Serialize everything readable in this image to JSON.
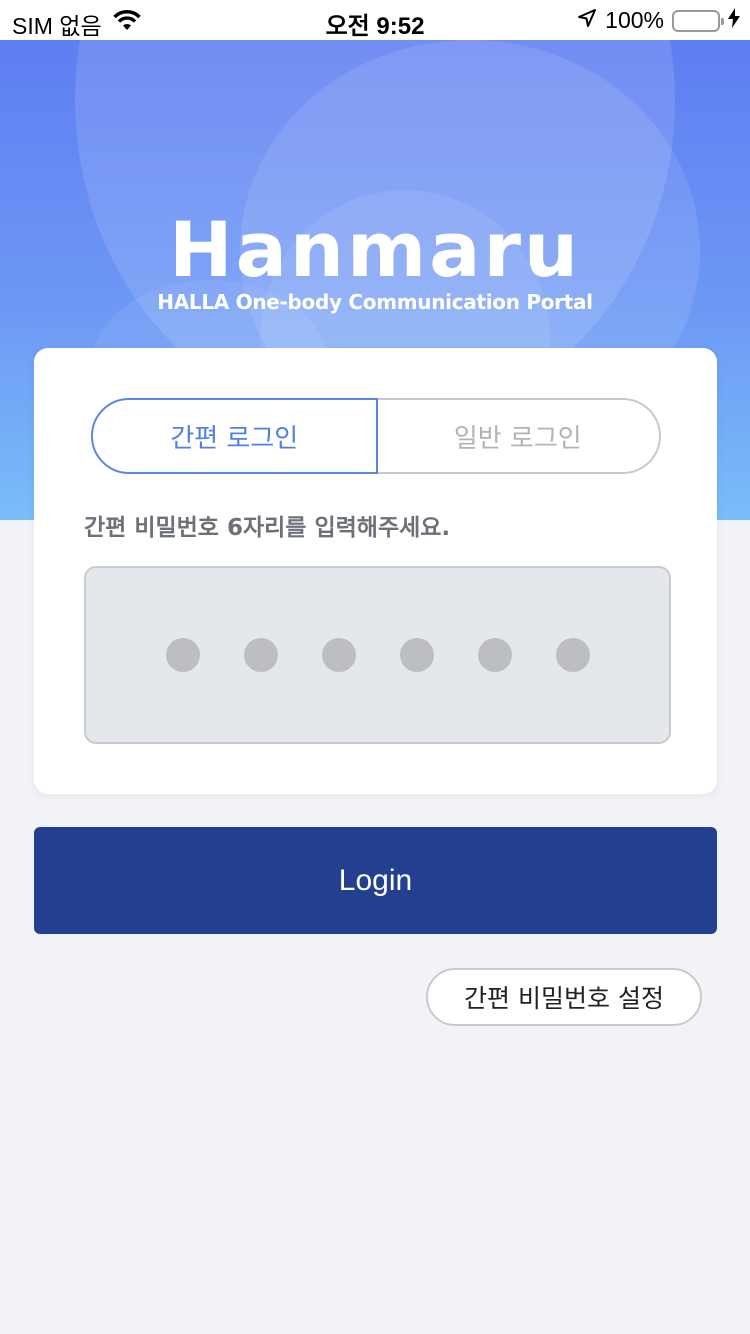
{
  "status_bar": {
    "carrier": "SIM 없음",
    "time": "오전 9:52",
    "battery_percent": "100%",
    "battery_level": 1.0,
    "wifi_icon": "wifi-icon",
    "location_icon": "location-arrow-icon",
    "charging_icon": "bolt-icon"
  },
  "brand": {
    "logo": "Hanmaru",
    "tagline": "HALLA One-body Communication Portal"
  },
  "login": {
    "tabs": [
      {
        "label": "간편 로그인",
        "active": true
      },
      {
        "label": "일반 로그인",
        "active": false
      }
    ],
    "instruction": "간편 비밀번호 6자리를 입력해주세요.",
    "pin_length": 6,
    "pin_entered": 0,
    "submit_label": "Login",
    "pin_setup_label": "간편 비밀번호 설정"
  },
  "colors": {
    "accent": "#4f80e6",
    "primary_button": "#233f8f",
    "background": "#f2f3f7"
  }
}
